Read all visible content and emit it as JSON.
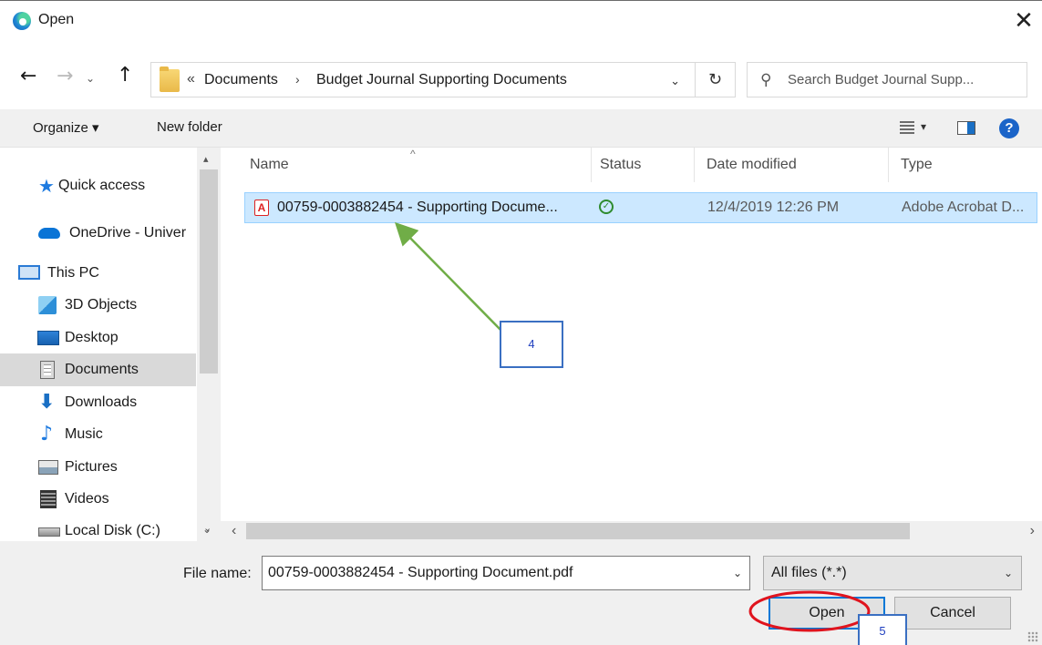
{
  "window": {
    "title": "Open",
    "close_glyph": "✕"
  },
  "nav": {
    "back_glyph": "←",
    "forward_glyph": "→",
    "recent_glyph": "⌄",
    "up_glyph": "↑",
    "address_chevron": "«",
    "crumbs": [
      "Documents",
      "Budget Journal Supporting Documents"
    ],
    "crumb_separator": "›",
    "address_dropdown_glyph": "⌄",
    "refresh_glyph": "↻",
    "search_placeholder": "Search Budget Journal Supp..."
  },
  "command_bar": {
    "organize_label": "Organize ▾",
    "new_folder_label": "New folder",
    "view_dropdown_glyph": "▾",
    "help_glyph": "?"
  },
  "sidebar": {
    "items": [
      {
        "label": "Quick access",
        "icon": "star-icon"
      },
      {
        "label": "OneDrive - Univer",
        "icon": "cloud-icon"
      },
      {
        "label": "This PC",
        "icon": "computer-icon"
      },
      {
        "label": "3D Objects",
        "icon": "cube-icon"
      },
      {
        "label": "Desktop",
        "icon": "desktop-icon"
      },
      {
        "label": "Documents",
        "icon": "document-icon",
        "selected": true
      },
      {
        "label": "Downloads",
        "icon": "download-icon"
      },
      {
        "label": "Music",
        "icon": "music-icon"
      },
      {
        "label": "Pictures",
        "icon": "pictures-icon"
      },
      {
        "label": "Videos",
        "icon": "videos-icon"
      },
      {
        "label": "Local Disk (C:)",
        "icon": "disk-icon"
      }
    ],
    "star_glyph": "★",
    "down_glyph": "⬇",
    "music_glyph": "♪",
    "scroll_up_glyph": "▴",
    "scroll_down_glyph": "⌄"
  },
  "file_list": {
    "columns": [
      "Name",
      "Status",
      "Date modified",
      "Type"
    ],
    "sort_glyph": "^",
    "rows": [
      {
        "name": "00759-0003882454 - Supporting Docume...",
        "status_glyph": "✓",
        "date_modified": "12/4/2019 12:26 PM",
        "type": "Adobe Acrobat D...",
        "pdf_glyph": "A"
      }
    ],
    "hscroll_left_glyph": "‹",
    "hscroll_right_glyph": "›"
  },
  "bottom": {
    "file_name_label": "File name:",
    "file_name_value": "00759-0003882454 - Supporting Document.pdf",
    "file_name_dropdown_glyph": "⌄",
    "file_type_value": "All files (*.*)",
    "file_type_dropdown_glyph": "⌄",
    "open_label": "Open",
    "cancel_label": "Cancel"
  },
  "annotations": {
    "callout_4": "4",
    "callout_5": "5"
  },
  "colors": {
    "accent": "#0078d7",
    "selection": "#cce8ff",
    "arrow": "#70ad47",
    "circle": "#e0141e"
  }
}
